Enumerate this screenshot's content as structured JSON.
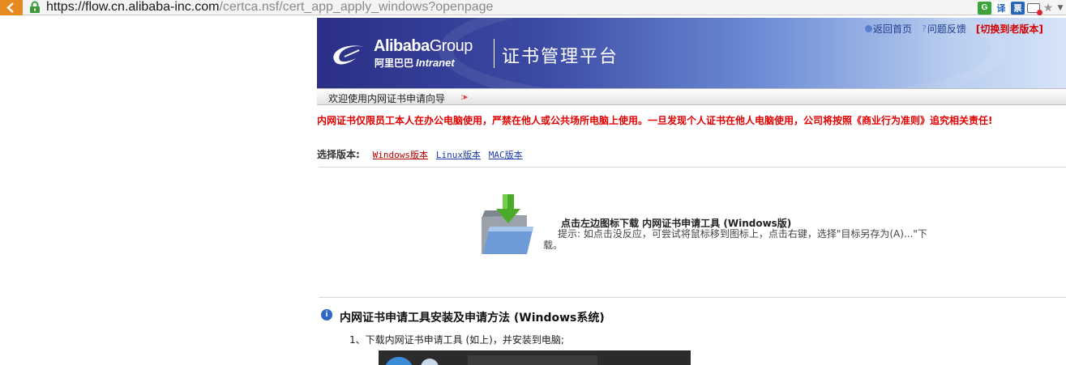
{
  "browser": {
    "url_host": "https://flow.cn.alibaba-inc.com",
    "url_path": "/certca.nsf/cert_app_apply_windows?openpage",
    "toolbar": {
      "g_label": "G",
      "translate_label": "译",
      "ticket_label": "票"
    }
  },
  "header": {
    "logo_word": "Alibaba",
    "logo_group": "Group",
    "logo_cn": "阿里巴巴",
    "logo_intranet": "Intranet",
    "platform_title": "证书管理平台",
    "links": {
      "home": "返回首页",
      "feedback": "问题反馈",
      "switch_old": "[切换到老版本]"
    }
  },
  "welcome": {
    "text": "欢迎使用内网证书申请向导"
  },
  "warning": "内网证书仅限员工本人在办公电脑使用，严禁在他人或公共场所电脑上使用。一旦发现个人证书在他人电脑使用，公司将按照《商业行为准则》追究相关责任!",
  "versions": {
    "label": "选择版本:",
    "windows": "Windows版本",
    "linux": "Linux版本",
    "mac": "MAC版本"
  },
  "download": {
    "title": "点击左边图标下载 内网证书申请工具 (Windows版)",
    "hint": "提示: 如点击没反应，可尝试将鼠标移到图标上，点击右键，选择\"目标另存为(A)...\"下载。"
  },
  "section": {
    "title": "内网证书申请工具安装及申请方法 (Windows系统)",
    "step1": "1、下载内网证书申请工具 (如上)，并安装到电脑;"
  },
  "colors": {
    "warning_red": "#e00000",
    "link_blue": "#1c3ea8",
    "active_link": "#b40000",
    "banner_dark": "#2b2f86"
  }
}
